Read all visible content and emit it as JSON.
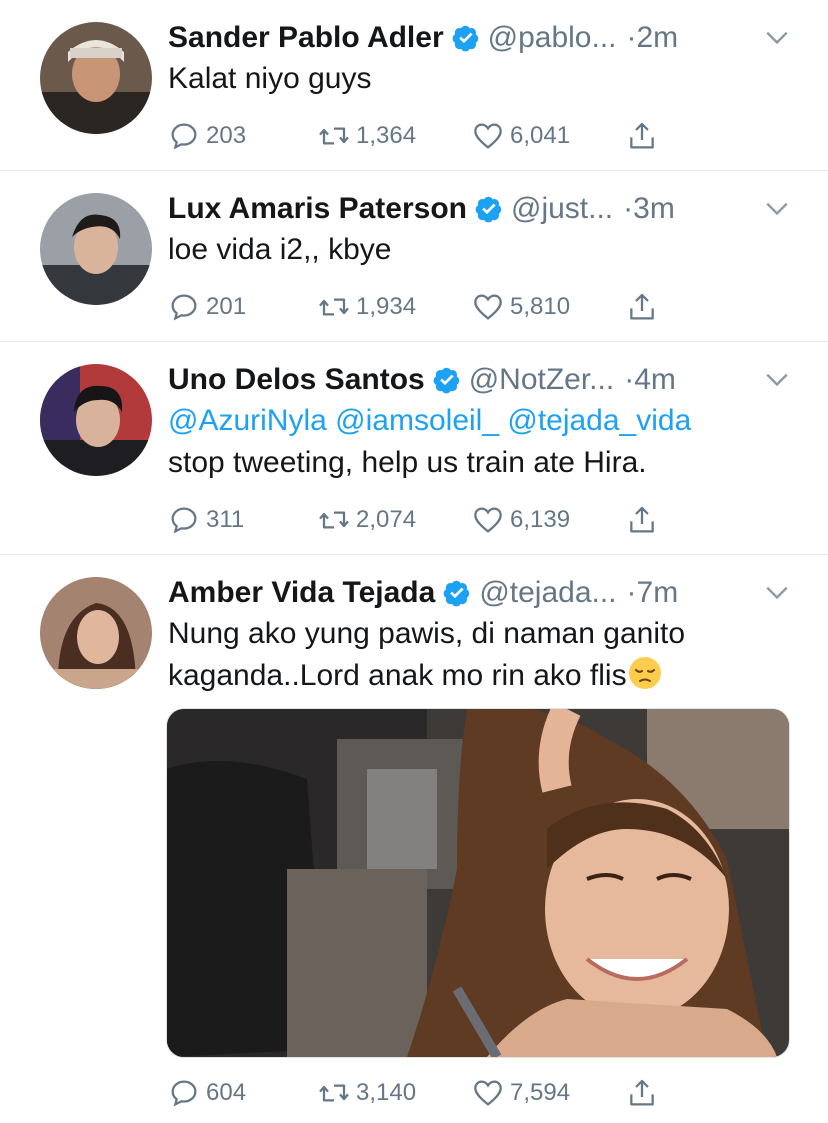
{
  "colors": {
    "accent": "#1da1f2",
    "secondary": "#657786",
    "text": "#14171a",
    "divider": "#e1e8ed"
  },
  "icons": [
    "verified-badge-icon",
    "chevron-down-icon",
    "reply-icon",
    "retweet-icon",
    "heart-icon",
    "share-icon",
    "pensive-face-emoji"
  ],
  "tweets": [
    {
      "name": "Sander Pablo Adler",
      "handle": "@pablo...",
      "time": "·2m",
      "text": "Kalat niyo guys",
      "replies": "203",
      "retweets": "1,364",
      "likes": "6,041"
    },
    {
      "name": "Lux Amaris Paterson",
      "handle": "@just...",
      "time": "·3m",
      "text": "loe vida i2,, kbye",
      "replies": "201",
      "retweets": "1,934",
      "likes": "5,810"
    },
    {
      "name": "Uno Delos Santos",
      "handle": "@NotZer...",
      "time": "·4m",
      "mentions": [
        "@AzuriNyla",
        "@iamsoleil_",
        "@tejada_vida"
      ],
      "text": "stop tweeting, help us train ate Hira.",
      "replies": "311",
      "retweets": "2,074",
      "likes": "6,139"
    },
    {
      "name": "Amber Vida Tejada",
      "handle": "@tejada...",
      "time": "·7m",
      "text_line1": "Nung ako yung pawis, di naman ganito",
      "text_line2": "kaganda..Lord anak mo rin ako flis",
      "replies": "604",
      "retweets": "3,140",
      "likes": "7,594"
    }
  ]
}
